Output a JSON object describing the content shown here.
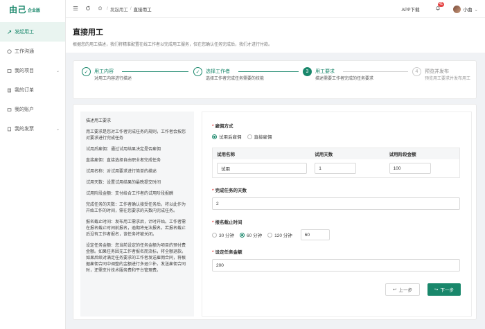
{
  "brand": {
    "logo": "由己",
    "edition": "企业版"
  },
  "sidebar": {
    "items": [
      {
        "label": "发起用工",
        "icon": "hire-icon",
        "active": true,
        "has_arrow": false
      },
      {
        "label": "工作沟通",
        "icon": "chat-icon",
        "active": false,
        "has_arrow": false
      },
      {
        "label": "我的项目",
        "icon": "project-icon",
        "active": false,
        "has_arrow": true
      },
      {
        "label": "我的订单",
        "icon": "order-icon",
        "active": false,
        "has_arrow": false
      },
      {
        "label": "我的账户",
        "icon": "account-icon",
        "active": false,
        "has_arrow": false
      },
      {
        "label": "我的发票",
        "icon": "invoice-icon",
        "active": false,
        "has_arrow": true
      }
    ]
  },
  "topbar": {
    "breadcrumb": [
      "发起用工",
      "直接用工"
    ],
    "app_download": "APP下载",
    "notification_count": "41",
    "username": "小曲"
  },
  "page": {
    "title": "直接用工",
    "description": "根据您的用工描述，我们将精准配置在线工作者以完成用工服务，仅在您确认任务完成后，我们才进行付款。"
  },
  "steps": [
    {
      "num": "1",
      "title": "用工内容",
      "desc": "对用工内容进行描述",
      "state": "done"
    },
    {
      "num": "2",
      "title": "选择工作者",
      "desc": "选择工作者完成任务需要的技能",
      "state": "done"
    },
    {
      "num": "3",
      "title": "用工要求",
      "desc": "描述需要工作者完成的任务要求",
      "state": "current"
    },
    {
      "num": "4",
      "title": "预览并发布",
      "desc": "预览用工要求并发布用工",
      "state": "todo"
    }
  ],
  "help": {
    "paragraphs": [
      "描述用工要求",
      "用工要求是您对工作者完成任务的规则，工作者会按您对要求进行完成任务",
      "试用后雇佣：通过试用结果决定是否雇佣",
      "直接雇佣：直接选择自由职业者完成任务",
      "试用名称：对试用要求进行简单的描述",
      "试用天数：设置试用结果的最晚提交时间",
      "试用阶段金额：支付给合工作者的试用阶段报酬",
      "完成任务的天数：工作者确认接受任务后，将以此作为开始工作的时间，需在您要求的天数内完成任务。",
      "报名截止时间：发布用工需求后，计时开始。工作者需在报名截止时间前报名，逾期将无法报名。若报名截止后没有工作者报名，该任务将被关闭。",
      "设定任务金额：您当前设定的任务金额为项目的预付费金额。如果任务因无工作者报名而流标，将全额退款。如果后续对满足任务要求的工作者发送雇佣合同，将根据雇佣合同中调整的金额进行多退少补。发送雇佣合同时，还需支付技术服务费和平台管理费。"
    ]
  },
  "form": {
    "hire_mode": {
      "label": "雇佣方式",
      "options": [
        "试用后雇佣",
        "直接雇佣"
      ],
      "selected": "试用后雇佣"
    },
    "trial_table": {
      "headers": [
        "试用名称",
        "试用天数",
        "试用阶段金额"
      ],
      "values": [
        "试用",
        "1",
        "100"
      ]
    },
    "days": {
      "label": "完成任务的天数",
      "value": "2"
    },
    "deadline": {
      "label": "报名截止时间",
      "options": [
        "30 分钟",
        "60 分钟",
        "120 分钟"
      ],
      "selected": "60 分钟",
      "custom_value": "60"
    },
    "amount": {
      "label": "设定任务金额",
      "value": "200"
    },
    "buttons": {
      "prev": "上一步",
      "next": "下一步"
    }
  },
  "colors": {
    "accent": "#19876b",
    "badge": "#e54545"
  }
}
